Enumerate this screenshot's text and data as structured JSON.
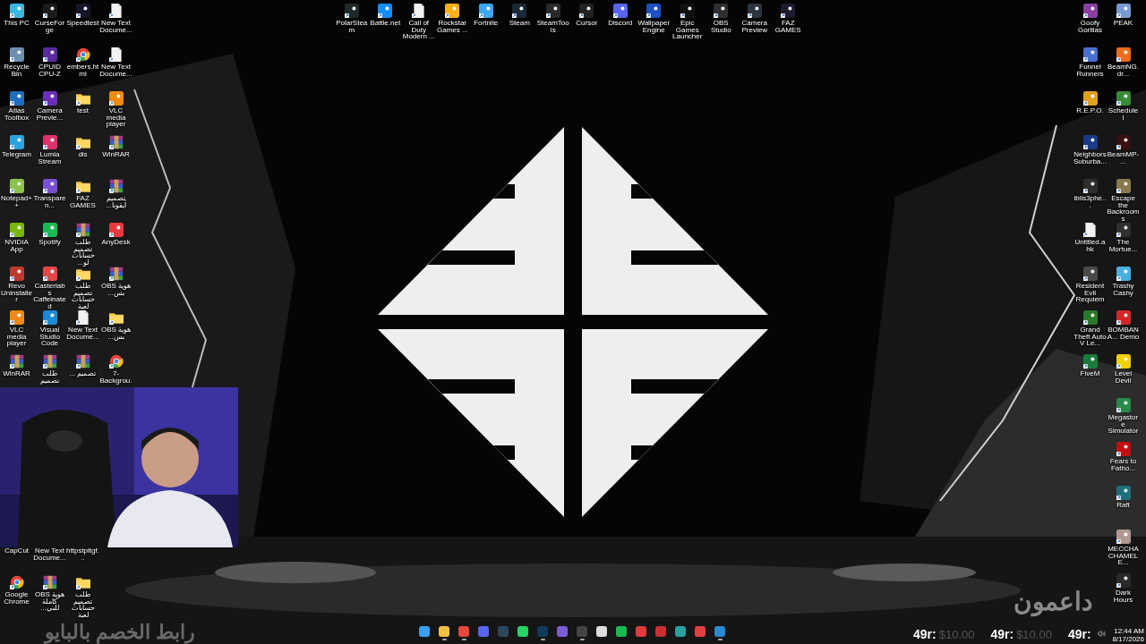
{
  "left_desktop": {
    "rows": [
      [
        {
          "label": "This PC",
          "kind": "app",
          "color": "#3ab8e0"
        },
        {
          "label": "CurseForge",
          "kind": "app",
          "color": "#1a1a1a"
        },
        {
          "label": "Speedtest",
          "kind": "app",
          "color": "#141526"
        },
        {
          "label": "New Text Docume...",
          "kind": "document"
        }
      ],
      [
        {
          "label": "Recycle Bin",
          "kind": "app",
          "color": "#6c8fb0"
        },
        {
          "label": "CPUID CPU-Z",
          "kind": "app",
          "color": "#5b2a9c"
        },
        {
          "label": "embers.html",
          "kind": "browser"
        },
        {
          "label": "New Text Docume...",
          "kind": "document"
        }
      ],
      [
        {
          "label": "Atlas Toolbox",
          "kind": "app",
          "color": "#1f6fc0"
        },
        {
          "label": "Camera Previe...",
          "kind": "app",
          "color": "#6a2fb5"
        },
        {
          "label": "test",
          "kind": "folder"
        },
        {
          "label": "VLC media player",
          "kind": "app",
          "color": "#f08a10"
        }
      ],
      [
        {
          "label": "Telegram",
          "kind": "app",
          "color": "#2aa3e0"
        },
        {
          "label": "Lumia Stream",
          "kind": "app",
          "color": "#e0306a"
        },
        {
          "label": "dis",
          "kind": "folder"
        },
        {
          "label": "WinRAR",
          "kind": "archive"
        }
      ],
      [
        {
          "label": "Notepad++",
          "kind": "app",
          "color": "#8bc34a"
        },
        {
          "label": "Transparen...",
          "kind": "app",
          "color": "#7a4fd0"
        },
        {
          "label": "FAZ GAMES",
          "kind": "folder"
        },
        {
          "label": "تصميم أيقونا...",
          "kind": "archive"
        }
      ],
      [
        {
          "label": "NVIDIA App",
          "kind": "app",
          "color": "#76b900"
        },
        {
          "label": "Spotify",
          "kind": "app",
          "color": "#1db954"
        },
        {
          "label": "طلب تصميم حسابات لو...",
          "kind": "archive"
        },
        {
          "label": "AnyDesk",
          "kind": "app",
          "color": "#e8383d"
        }
      ],
      [
        {
          "label": "Revo Uninstaller",
          "kind": "app",
          "color": "#c0392b"
        },
        {
          "label": "Casterlabs Caffeinated",
          "kind": "app",
          "color": "#e04848"
        },
        {
          "label": "طلب تصميم حسابات لعبة",
          "kind": "folder"
        },
        {
          "label": "هوية OBS بس...",
          "kind": "archive"
        }
      ],
      [
        {
          "label": "VLC media player",
          "kind": "app",
          "color": "#f08a10"
        },
        {
          "label": "Visual Studio Code",
          "kind": "app",
          "color": "#1e8ad6"
        },
        {
          "label": "New Text Docume...",
          "kind": "document"
        },
        {
          "label": "هوية OBS بس...",
          "kind": "folder"
        }
      ],
      [
        {
          "label": "WinRAR",
          "kind": "archive"
        },
        {
          "label": "طلب تصميم",
          "kind": "archive"
        },
        {
          "label": "تصميم ...",
          "kind": "archive"
        },
        {
          "label": "7-Backgrou...",
          "kind": "browser"
        }
      ]
    ],
    "lower_columns": [
      [
        {
          "label": "CapCut"
        },
        {
          "label": "Google Chrome",
          "kind": "browser"
        }
      ],
      [
        {
          "label": "New Text Docume..."
        },
        {
          "label": "هوية OBS كاملة للبي...",
          "kind": "archive"
        }
      ],
      [
        {
          "label": "httpstpitgf..."
        },
        {
          "label": "طلب تصميم حسابات لعبة",
          "kind": "folder"
        }
      ]
    ]
  },
  "top_desktop": [
    {
      "label": "PolarSteam",
      "kind": "app",
      "color": "#1e2a2a"
    },
    {
      "label": "Battle.net",
      "kind": "app",
      "color": "#148eff"
    },
    {
      "label": "Call of Duty Modern ...",
      "kind": "document"
    },
    {
      "label": "Rockstar Games ...",
      "kind": "app",
      "color": "#fcaf17"
    },
    {
      "label": "Fortnite",
      "kind": "app",
      "color": "#3aa8f0"
    },
    {
      "label": "Steam",
      "kind": "app",
      "color": "#1b2838"
    },
    {
      "label": "SteamTools",
      "kind": "app",
      "color": "#2a2a2a"
    },
    {
      "label": "Cursor",
      "kind": "app",
      "color": "#222222"
    },
    {
      "label": "Discord",
      "kind": "app",
      "color": "#5865f2"
    },
    {
      "label": "Wallpaper Engine",
      "kind": "app",
      "color": "#1f4fc0"
    },
    {
      "label": "Epic Games Launcher",
      "kind": "app",
      "color": "#111111"
    },
    {
      "label": "OBS Studio",
      "kind": "app",
      "color": "#302e31"
    },
    {
      "label": "Camera Preview",
      "kind": "app",
      "color": "#2c3440"
    },
    {
      "label": "FAZ GAMES",
      "kind": "app",
      "color": "#1e1a2e"
    }
  ],
  "right_desktop": {
    "columns": [
      [
        {
          "label": "Goofy Gorillas",
          "kind": "app",
          "color": "#8a3fa0"
        },
        {
          "label": "Funnel Runners",
          "kind": "app",
          "color": "#4a6fd0"
        },
        {
          "label": "R.E.P.O.",
          "kind": "app",
          "color": "#e0a020"
        },
        {
          "label": "Neighbors Suburba...",
          "kind": "app",
          "color": "#1a3a8a"
        },
        {
          "label": "iblis3phe...",
          "kind": "app",
          "color": "#2e2e2e"
        },
        {
          "label": "Untitled.ahk",
          "kind": "document"
        },
        {
          "label": "Resident Evil Requiem",
          "kind": "app",
          "color": "#4a4a4a"
        },
        {
          "label": "Grand Theft Auto V Le...",
          "kind": "app",
          "color": "#2a7a2a"
        },
        {
          "label": "FiveM",
          "kind": "app",
          "color": "#1c7a3a"
        }
      ],
      [
        {
          "label": "PEAK",
          "kind": "app",
          "color": "#7a9ad0"
        },
        {
          "label": "BeamNG.dr...",
          "kind": "app",
          "color": "#ef6a1a"
        },
        {
          "label": "Schedule I",
          "kind": "app",
          "color": "#3a8a3a"
        },
        {
          "label": "BeamMP-...",
          "kind": "app",
          "color": "#3a1010"
        },
        {
          "label": "Escape the Backrooms",
          "kind": "app",
          "color": "#8a7a50"
        },
        {
          "label": "The Mortue...",
          "kind": "app",
          "color": "#303030"
        },
        {
          "label": "Trashy Cashy",
          "kind": "app",
          "color": "#4ab0e0"
        },
        {
          "label": "BOMBANA... Demo",
          "kind": "app",
          "color": "#d02828"
        },
        {
          "label": "Level Devil",
          "kind": "app",
          "color": "#f0d000"
        },
        {
          "label": "Megastore Simulator",
          "kind": "app",
          "color": "#2a8a4a"
        },
        {
          "label": "Fears to Fatho...",
          "kind": "app",
          "color": "#c01010"
        },
        {
          "label": "Raft",
          "kind": "app",
          "color": "#1f6f7a"
        },
        {
          "label": "MECCHA CHAMELE...",
          "kind": "app",
          "color": "#b09a90"
        },
        {
          "label": "Dark Hours",
          "kind": "app",
          "color": "#2a2a2a"
        }
      ]
    ]
  },
  "overlay": {
    "supporters_title": "داعمون",
    "discount_text": "رابط الخصم بالبايو",
    "donations": [
      {
        "name": "49r:",
        "amount": "$10.00"
      },
      {
        "name": "49r:",
        "amount": "$10.00"
      },
      {
        "name": "49r:"
      }
    ]
  },
  "taskbar": {
    "apps": [
      {
        "color": "#3aa0f0",
        "running": false
      },
      {
        "color": "#f0c040",
        "running": true
      },
      {
        "color": "#e8453c",
        "running": true
      },
      {
        "color": "#5865f2",
        "running": false
      },
      {
        "color": "#2a475e",
        "running": false
      },
      {
        "color": "#25d366",
        "running": false
      },
      {
        "color": "#0f3a5a",
        "running": true
      },
      {
        "color": "#7b5cd6",
        "running": false
      },
      {
        "color": "#444444",
        "running": true
      },
      {
        "color": "#dddddd",
        "running": false
      },
      {
        "color": "#1db954",
        "running": false
      },
      {
        "color": "#e03c3c",
        "running": false
      },
      {
        "color": "#c83030",
        "running": false
      },
      {
        "color": "#2aa0a0",
        "running": false
      },
      {
        "color": "#e04040",
        "running": false
      },
      {
        "color": "#2a8ad0",
        "running": true
      }
    ],
    "time": "12:44 AM",
    "date": "8/17/2026"
  }
}
